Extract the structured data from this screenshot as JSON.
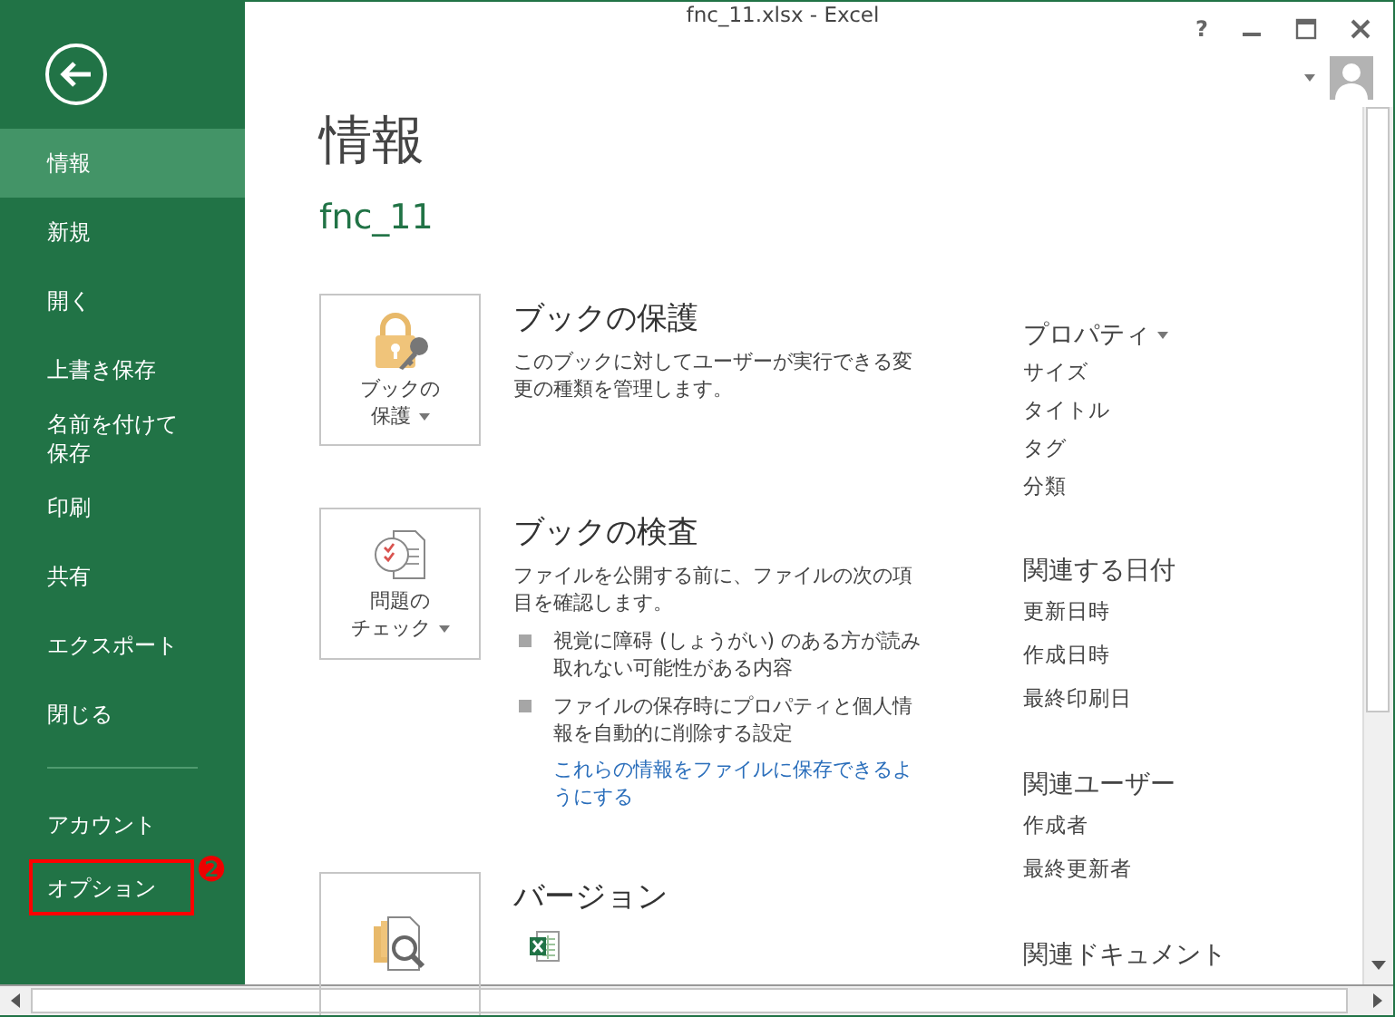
{
  "window": {
    "title": "fnc_11.xlsx - Excel",
    "controls": [
      "?"
    ]
  },
  "sidebar": {
    "items": [
      {
        "label": "情報",
        "selected": true,
        "highlighted": false
      },
      {
        "label": "新規",
        "selected": false,
        "highlighted": false
      },
      {
        "label": "開く",
        "selected": false,
        "highlighted": false
      },
      {
        "label": "上書き保存",
        "selected": false,
        "highlighted": false
      },
      {
        "label": "名前を付けて保存",
        "selected": false,
        "highlighted": false
      },
      {
        "label": "印刷",
        "selected": false,
        "highlighted": false
      },
      {
        "label": "共有",
        "selected": false,
        "highlighted": false
      },
      {
        "label": "エクスポート",
        "selected": false,
        "highlighted": false
      },
      {
        "label": "閉じる",
        "selected": false,
        "highlighted": false
      }
    ],
    "bottom_items": [
      {
        "label": "アカウント",
        "selected": false,
        "highlighted": false
      },
      {
        "label": "オプション",
        "selected": false,
        "highlighted": true
      }
    ],
    "step_badge": "❷"
  },
  "page": {
    "heading": "情報",
    "file_name": "fnc_11"
  },
  "sections": [
    {
      "kind": "protect",
      "button_lines": [
        "ブックの",
        "保護"
      ],
      "title": "ブックの保護",
      "description": "このブックに対してユーザーが実行できる変更の種類を管理します。"
    },
    {
      "kind": "inspect",
      "button_lines": [
        "問題の",
        "チェック"
      ],
      "title": "ブックの検査",
      "description": "ファイルを公開する前に、ファイルの次の項目を確認します。",
      "bullets": [
        "視覚に障碍 (しょうがい) のある方が読み取れない可能性がある内容",
        "ファイルの保存時にプロパティと個人情報を自動的に削除する設定"
      ],
      "link": "これらの情報をファイルに保存できるようにする"
    },
    {
      "kind": "versions",
      "title": "バージョン"
    }
  ],
  "properties": {
    "groups": [
      {
        "title": "プロパティ",
        "dropdown": true,
        "items": [
          "サイズ",
          "タイトル",
          "タグ",
          "分類"
        ]
      },
      {
        "title": "関連する日付",
        "dropdown": false,
        "items": [
          "更新日時",
          "作成日時",
          "最終印刷日"
        ]
      },
      {
        "title": "関連ユーザー",
        "dropdown": false,
        "items": [
          "作成者",
          "最終更新者"
        ]
      },
      {
        "title": "関連ドキュメント",
        "dropdown": false
      }
    ]
  }
}
